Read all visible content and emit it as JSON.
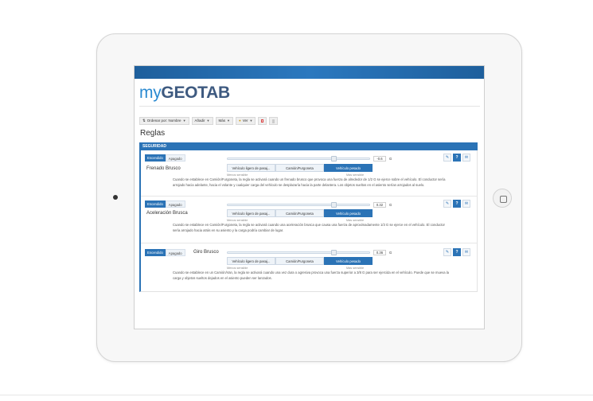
{
  "app": {
    "logo_my": "my",
    "logo_geotab": "GEOTAB"
  },
  "toolbar": {
    "sort_label": "Ordenar por: Nombre",
    "add_label": "Añadir",
    "more_label": "Más",
    "view_label": "Ver"
  },
  "page": {
    "title": "Reglas",
    "section": "SEGURIDAD"
  },
  "toggle": {
    "on": "Encendido",
    "off": "Apagado"
  },
  "vehicle_types": [
    "Vehículo ligero de pasaj...",
    "Camión/Furgoneta",
    "Vehículo pesado"
  ],
  "hints": {
    "less": "Menos sensible",
    "more": "Más sensible"
  },
  "rules": [
    {
      "name": "Frenado Brusco",
      "value": "-0.6",
      "unit": "G",
      "slider_fraction": 0.75,
      "description": "Cuando se establece en Camión/Furgoneta, la regla se activará cuando un frenado brusco que provoca una fuerza de alrededor de 1/2 G se ejerce sobre el vehículo. El conductor sería arrojado hacia adelante, hacia el volante y cualquier carga del vehículo se desplazaría hacia la parte delantera. Los objetos sueltos en el asiento serían arrojados al suelo."
    },
    {
      "name": "Aceleración Brusca",
      "value": "0.32",
      "unit": "G",
      "slider_fraction": 0.75,
      "description": "Cuando se establece en Camión/Furgoneta, la regla se activará cuando una aceleración brusca que causa una fuerza de aproximadamente 1/3 G se ejerce en el vehículo. El conductor sería arrojado hacia atrás en su asiento y la carga podría cambiar de lugar."
    },
    {
      "name": "Giro Brusco",
      "value": "0.36",
      "unit": "G",
      "slider_fraction": 0.75,
      "description": "Cuando se establece en un Camión/Van, la regla se activará cuando una vez dura o agresiva provoca una fuerza superior a 3/8 G para ser ejercida en el vehículo. Puede que se mueva la carga y objetos sueltos dejados en el asiento pueden ser lanzados."
    }
  ]
}
